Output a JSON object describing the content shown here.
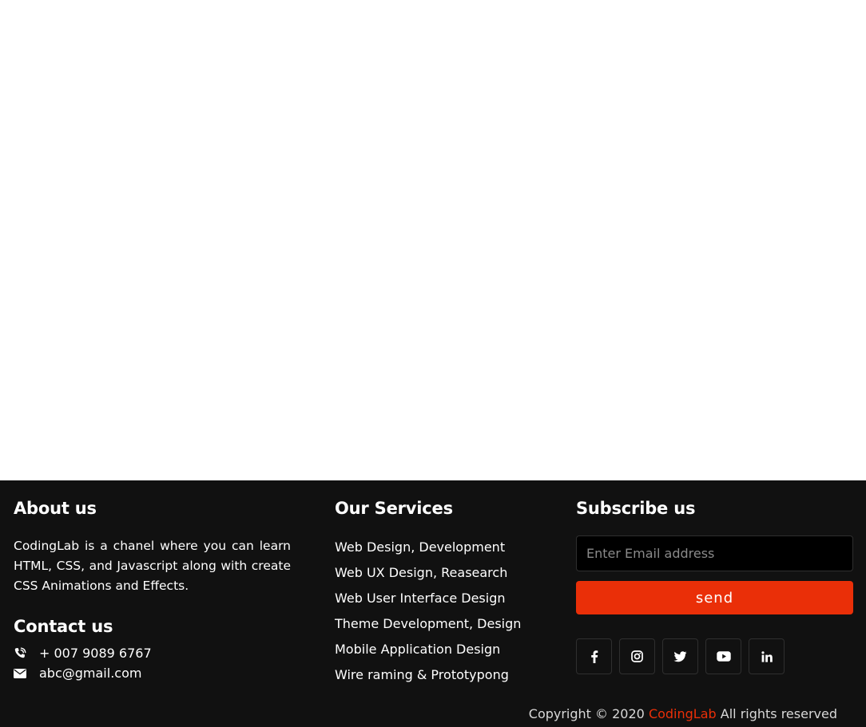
{
  "about": {
    "title": "About us",
    "text": "CodingLab is a chanel where you can learn HTML, CSS, and Javascript along with create CSS Animations and Effects."
  },
  "contact": {
    "title": "Contact us",
    "phone": "+ 007 9089 6767",
    "email": "abc@gmail.com",
    "phone_icon": "phone-icon",
    "email_icon": "envelope-icon"
  },
  "services": {
    "title": "Our Services",
    "items": [
      "Web Design, Development",
      "Web UX Design, Reasearch",
      "Web User Interface Design",
      "Theme Development, Design",
      "Mobile Application Design",
      "Wire raming & Prototypong"
    ]
  },
  "subscribe": {
    "title": "Subscribe us",
    "placeholder": "Enter Email address",
    "value": "",
    "button_label": "send"
  },
  "social_icons": [
    "facebook-icon",
    "instagram-icon",
    "twitter-icon",
    "youtube-icon",
    "linkedin-icon"
  ],
  "copyright": {
    "prefix": "Copyright © 2020",
    "brand": "CodingLab",
    "suffix": "All rights reserved"
  },
  "colors": {
    "footer_bg": "#111111",
    "accent": "#ea2f08",
    "input_bg": "#000000"
  }
}
